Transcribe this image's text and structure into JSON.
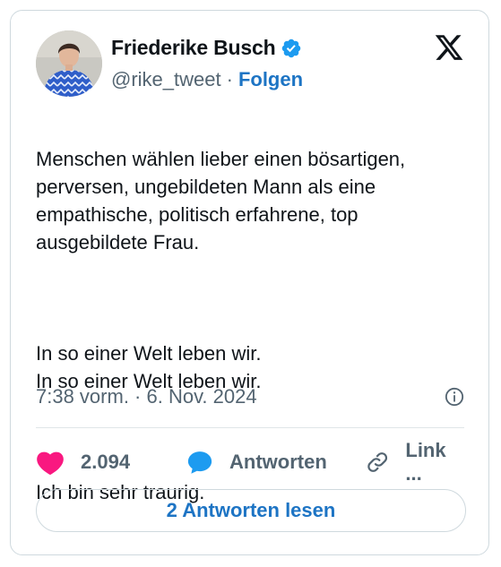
{
  "author": {
    "name": "Friederike Busch",
    "handle": "@rike_tweet",
    "separator": "·",
    "follow_label": "Folgen"
  },
  "tweet": {
    "paragraph_1": "Menschen wählen lieber einen bösartigen,\nperversen, ungebildeten Mann als eine\nempathische, politisch erfahrene, top\nausgebildete Frau.",
    "paragraph_2": "In so einer Welt leben wir.\nIn so einer Welt leben wir.",
    "paragraph_3": "Ich bin sehr traurig.",
    "timestamp": "7:38 vorm. · 6. Nov. 2024"
  },
  "actions": {
    "like_count": "2.094",
    "reply_label": "Antworten",
    "link_label": "Link ..."
  },
  "read_replies_label": "2 Antworten lesen",
  "colors": {
    "link_blue": "#1d74c4",
    "verified_blue": "#1d9bf0",
    "heart_pink": "#f91880",
    "text_primary": "#0f1419",
    "text_secondary": "#536471",
    "border": "#cfd9de"
  },
  "icons": [
    "verified-badge-icon",
    "x-logo-icon",
    "info-icon",
    "heart-icon",
    "reply-bubble-icon",
    "link-icon"
  ]
}
